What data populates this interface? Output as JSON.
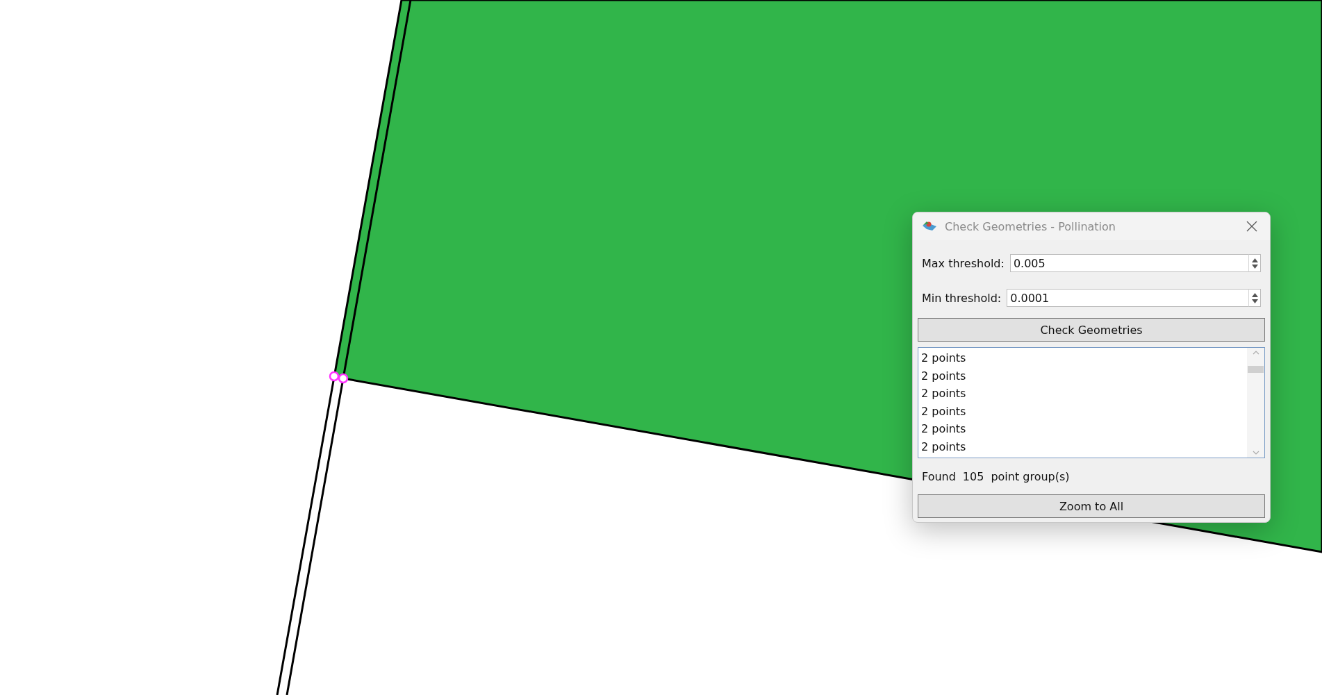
{
  "dialog": {
    "title": "Check Geometries - Pollination",
    "fields": [
      {
        "label": "Max threshold:",
        "value": "0.005"
      },
      {
        "label": "Min threshold:",
        "value": "0.0001"
      }
    ],
    "check_button": "Check Geometries",
    "results": [
      "2 points",
      "2 points",
      "2 points",
      "2 points",
      "2 points",
      "2 points"
    ],
    "summary": {
      "prefix": "Found",
      "count": "105",
      "suffix": "point group(s)"
    },
    "zoom_button": "Zoom to All"
  }
}
